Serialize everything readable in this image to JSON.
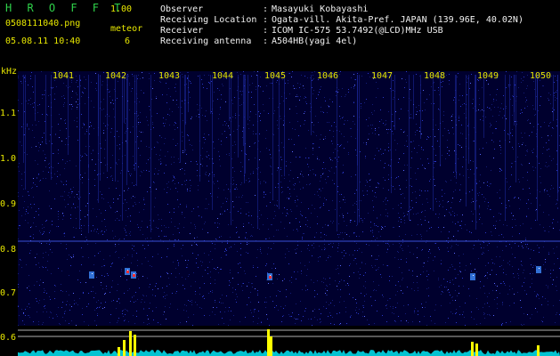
{
  "app": {
    "name": "H R O F F T",
    "version": "1.00"
  },
  "file": {
    "name": "0508111040.png",
    "timestamp": "05.08.11 10:40"
  },
  "meteor": {
    "label": "meteor",
    "count": "6"
  },
  "station": {
    "rows": [
      {
        "label": "Observer",
        "sep": ":",
        "value": "Masayuki Kobayashi"
      },
      {
        "label": "Receiving Location",
        "sep": ":",
        "value": "Ogata-vill. Akita-Pref. JAPAN (139.96E, 40.02N)"
      },
      {
        "label": "Receiver",
        "sep": ":",
        "value": "ICOM IC-575 53.7492(@LCD)MHz USB"
      },
      {
        "label": "Receiving antenna",
        "sep": ":",
        "value": "A504HB(yagi 4el)"
      }
    ]
  },
  "axis": {
    "y_unit": "kHz",
    "y_ticks": [
      "1.1",
      "1.0",
      "0.9",
      "0.8",
      "0.7",
      "0.6"
    ],
    "y_values": [
      1.1,
      1.0,
      0.9,
      0.8,
      0.7,
      0.6
    ],
    "x_ticks": [
      "1041",
      "1042",
      "1043",
      "1044",
      "1045",
      "1046",
      "1047",
      "1048",
      "1049",
      "1050"
    ]
  },
  "colors": {
    "background": "#000000",
    "waterfall": "#00002e",
    "noise": "#2a37c8",
    "label": "#e8e800",
    "title": "#2fd24a",
    "text": "#f2f2f2",
    "signal": "#00d8e8",
    "peak": "#ffff00",
    "echo": "#ff3030"
  }
}
